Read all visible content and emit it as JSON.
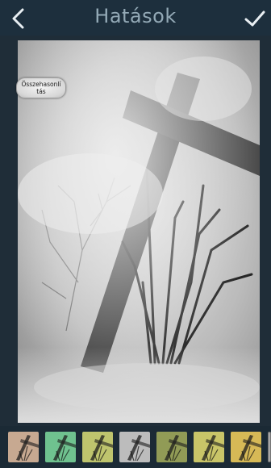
{
  "header": {
    "title": "Hatások",
    "back_icon": "chevron-left-icon",
    "confirm_icon": "checkmark-icon"
  },
  "photo": {
    "compare_label_line1": "Összehasonlí",
    "compare_label_line2": "tás"
  },
  "filters": [
    {
      "name": "filter-1",
      "tint": "#b58d6c"
    },
    {
      "name": "filter-2",
      "tint": "#3fae6a"
    },
    {
      "name": "filter-3",
      "tint": "#a8b03c"
    },
    {
      "name": "filter-4",
      "tint": "#a6a6a6"
    },
    {
      "name": "filter-5",
      "tint": "#6d7a1e"
    },
    {
      "name": "filter-6",
      "tint": "#b7b236"
    },
    {
      "name": "filter-7",
      "tint": "#c9a21e"
    }
  ],
  "colors": {
    "topbar": "#1d2f3d",
    "title_text": "#93a9b6",
    "background": "#1a2b38"
  }
}
